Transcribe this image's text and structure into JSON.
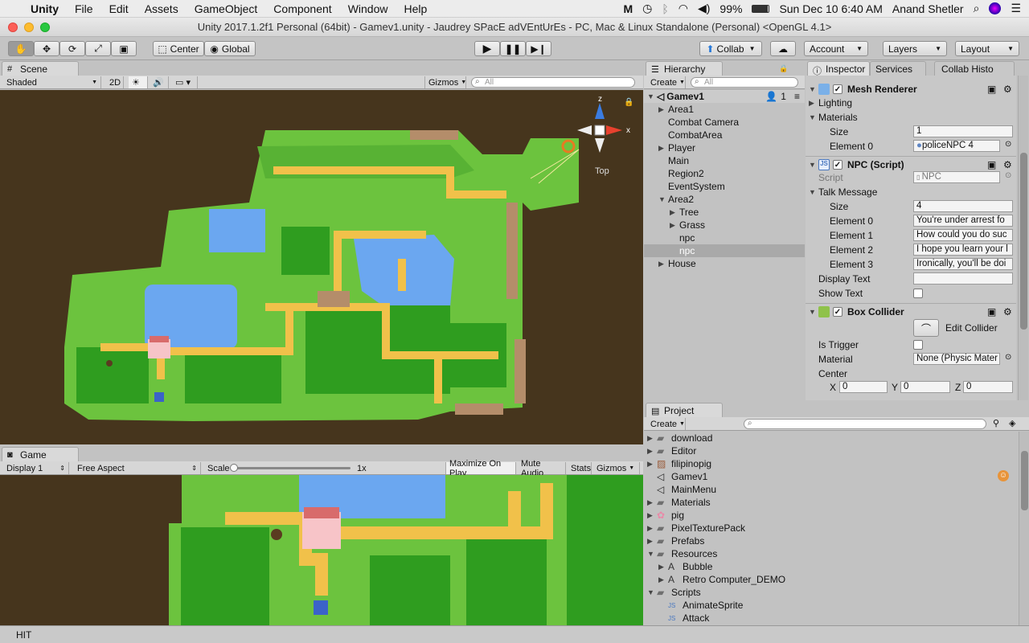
{
  "menubar": {
    "app": "Unity",
    "items": [
      "File",
      "Edit",
      "Assets",
      "GameObject",
      "Component",
      "Window",
      "Help"
    ],
    "battery": "99%",
    "datetime": "Sun Dec 10  6:40 AM",
    "user": "Anand Shetler"
  },
  "window": {
    "title": "Unity 2017.1.2f1 Personal (64bit) - Gamev1.unity - Jaudrey SPacE adVEntUrEs - PC, Mac & Linux Standalone (Personal) <OpenGL 4.1>"
  },
  "toolbar": {
    "pivot": "Center",
    "space": "Global",
    "collab": "Collab",
    "account": "Account",
    "layers": "Layers",
    "layout": "Layout"
  },
  "scene": {
    "tab": "Scene",
    "shading": "Shaded",
    "mode2d": "2D",
    "gizmos": "Gizmos",
    "search_placeholder": "All",
    "gizmo_axes": {
      "z": "z",
      "x": "x",
      "view": "Top"
    }
  },
  "game": {
    "tab": "Game",
    "display": "Display 1",
    "aspect": "Free Aspect",
    "scale_label": "Scale",
    "scale_value": "1x",
    "maximize": "Maximize On Play",
    "mute": "Mute Audio",
    "stats": "Stats",
    "gizmos": "Gizmos"
  },
  "hierarchy": {
    "tab": "Hierarchy",
    "create": "Create",
    "search_placeholder": "All",
    "scene_name": "Gamev1",
    "user_count": "1",
    "items": [
      {
        "label": "Area1",
        "indent": 1,
        "arrow": "right",
        "selected": false
      },
      {
        "label": "Combat Camera",
        "indent": 1,
        "arrow": "",
        "selected": false
      },
      {
        "label": "CombatArea",
        "indent": 1,
        "arrow": "",
        "selected": false
      },
      {
        "label": "Player",
        "indent": 1,
        "arrow": "right",
        "selected": false
      },
      {
        "label": "Main",
        "indent": 1,
        "arrow": "",
        "selected": false
      },
      {
        "label": "Region2",
        "indent": 1,
        "arrow": "",
        "selected": false
      },
      {
        "label": "EventSystem",
        "indent": 1,
        "arrow": "",
        "selected": false
      },
      {
        "label": "Area2",
        "indent": 1,
        "arrow": "down",
        "selected": false
      },
      {
        "label": "Tree",
        "indent": 2,
        "arrow": "right",
        "selected": false
      },
      {
        "label": "Grass",
        "indent": 2,
        "arrow": "right",
        "selected": false
      },
      {
        "label": "npc",
        "indent": 2,
        "arrow": "",
        "selected": false
      },
      {
        "label": "npc",
        "indent": 2,
        "arrow": "",
        "selected": true
      },
      {
        "label": "House",
        "indent": 1,
        "arrow": "right",
        "selected": false
      }
    ]
  },
  "inspector": {
    "tabs": [
      "Inspector",
      "Services",
      "Collab Histo"
    ],
    "mesh_renderer": {
      "title": "Mesh Renderer",
      "lighting": "Lighting",
      "materials": "Materials",
      "size_label": "Size",
      "size_value": "1",
      "element0_label": "Element 0",
      "element0_value": "policeNPC 4"
    },
    "npc_script": {
      "title": "NPC (Script)",
      "script_label": "Script",
      "script_value": "NPC",
      "talk_message": "Talk Message",
      "size_label": "Size",
      "size_value": "4",
      "elements": [
        {
          "label": "Element 0",
          "value": "You're under arrest fo"
        },
        {
          "label": "Element 1",
          "value": "How could you do suc"
        },
        {
          "label": "Element 2",
          "value": "I hope you learn your l"
        },
        {
          "label": "Element 3",
          "value": "Ironically, you'll be doi"
        }
      ],
      "display_text": "Display Text",
      "show_text": "Show Text"
    },
    "box_collider": {
      "title": "Box Collider",
      "edit_collider": "Edit Collider",
      "is_trigger": "Is Trigger",
      "material_label": "Material",
      "material_value": "None (Physic Mater",
      "center_label": "Center",
      "x_label": "X",
      "x_value": "0",
      "y_label": "Y",
      "y_value": "0",
      "z_label": "Z",
      "z_value": "0"
    }
  },
  "project": {
    "tab": "Project",
    "create": "Create",
    "items": [
      {
        "label": "download",
        "icon": "folder",
        "arrow": "right",
        "indent": 0
      },
      {
        "label": "Editor",
        "icon": "folder",
        "arrow": "right",
        "indent": 0
      },
      {
        "label": "filipinopig",
        "icon": "image",
        "arrow": "right",
        "indent": 0
      },
      {
        "label": "Gamev1",
        "icon": "unity",
        "arrow": "",
        "indent": 0
      },
      {
        "label": "MainMenu",
        "icon": "unity",
        "arrow": "",
        "indent": 0
      },
      {
        "label": "Materials",
        "icon": "folder",
        "arrow": "right",
        "indent": 0
      },
      {
        "label": "pig",
        "icon": "pig",
        "arrow": "right",
        "indent": 0
      },
      {
        "label": "PixelTexturePack",
        "icon": "folder",
        "arrow": "right",
        "indent": 0
      },
      {
        "label": "Prefabs",
        "icon": "folder",
        "arrow": "right",
        "indent": 0
      },
      {
        "label": "Resources",
        "icon": "folder",
        "arrow": "down",
        "indent": 0
      },
      {
        "label": "Bubble",
        "icon": "font",
        "arrow": "right",
        "indent": 1
      },
      {
        "label": "Retro Computer_DEMO",
        "icon": "font",
        "arrow": "right",
        "indent": 1
      },
      {
        "label": "Scripts",
        "icon": "folder",
        "arrow": "down",
        "indent": 0
      },
      {
        "label": "AnimateSprite",
        "icon": "script",
        "arrow": "",
        "indent": 1
      },
      {
        "label": "Attack",
        "icon": "script",
        "arrow": "",
        "indent": 1
      }
    ]
  },
  "status": {
    "text": "HIT"
  }
}
